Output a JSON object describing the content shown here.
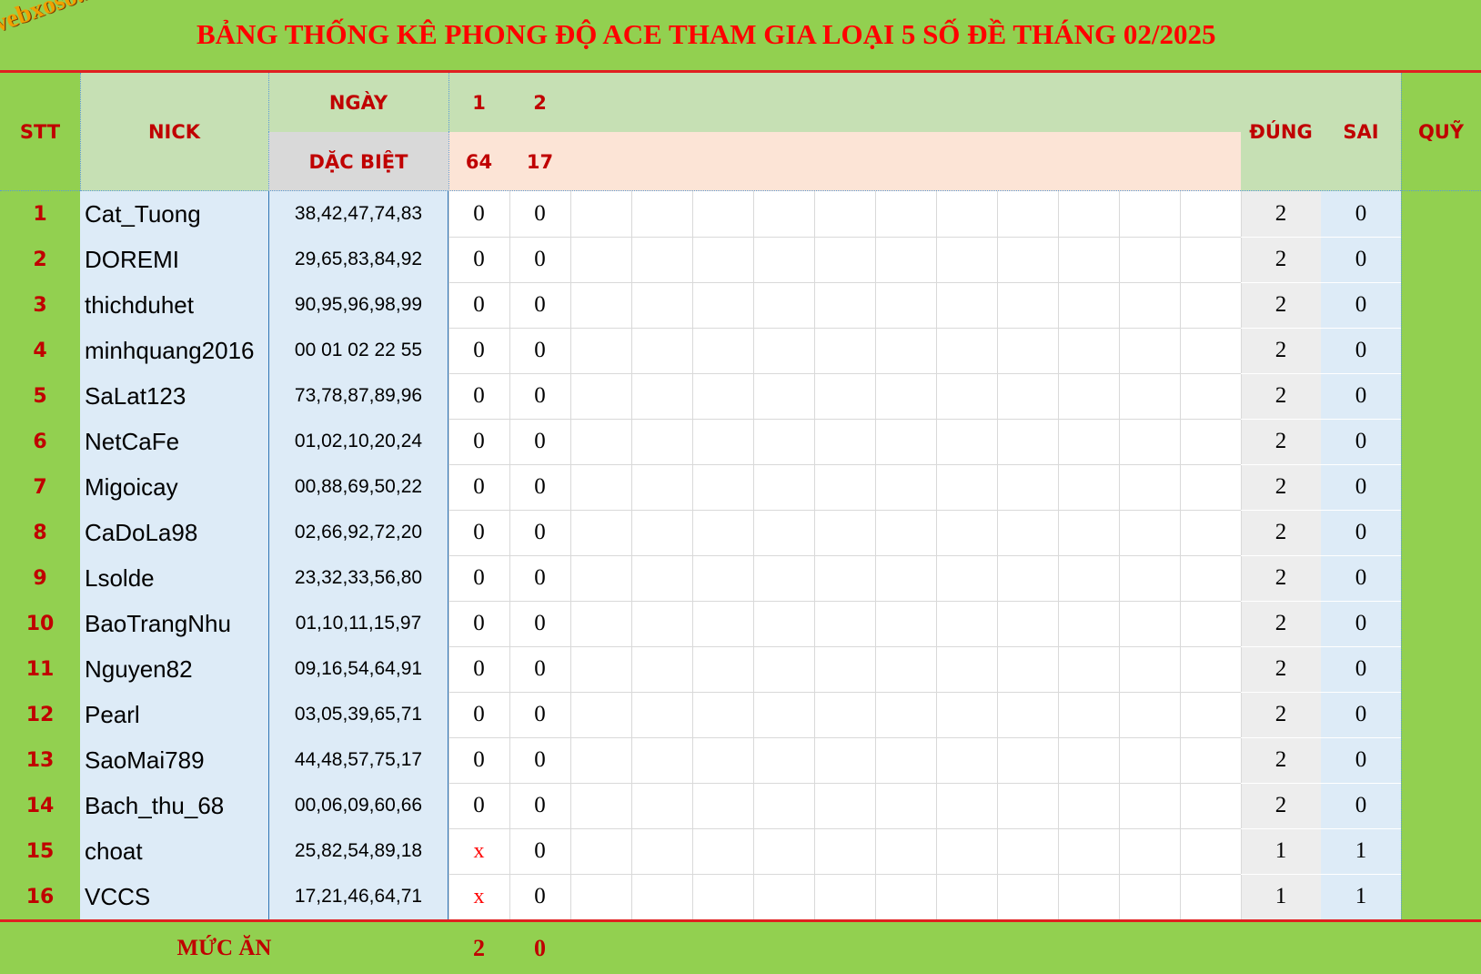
{
  "title": "BẢNG THỐNG KÊ PHONG ĐỘ ACE THAM GIA LOẠI 5 SỐ ĐỀ THÁNG 02/2025",
  "logo": "webxoso.net",
  "headers": {
    "stt": "STT",
    "nick": "NICK",
    "ngay": "NGÀY",
    "dac_biet": "DẶC BIỆT",
    "dung": "ĐÚNG",
    "sai": "SAI",
    "quy": "QUỸ"
  },
  "days": [
    "1",
    "2"
  ],
  "specials": [
    "64",
    "17"
  ],
  "rows": [
    {
      "stt": "1",
      "nick": "Cat_Tuong",
      "numbers": "38,42,47,74,83",
      "d1": "0",
      "d2": "0",
      "dung": "2",
      "sai": "0"
    },
    {
      "stt": "2",
      "nick": "DOREMI",
      "numbers": "29,65,83,84,92",
      "d1": "0",
      "d2": "0",
      "dung": "2",
      "sai": "0"
    },
    {
      "stt": "3",
      "nick": "thichduhet",
      "numbers": "90,95,96,98,99",
      "d1": "0",
      "d2": "0",
      "dung": "2",
      "sai": "0"
    },
    {
      "stt": "4",
      "nick": "minhquang2016",
      "numbers": "00 01 02 22 55",
      "d1": "0",
      "d2": "0",
      "dung": "2",
      "sai": "0"
    },
    {
      "stt": "5",
      "nick": "SaLat123",
      "numbers": "73,78,87,89,96",
      "d1": "0",
      "d2": "0",
      "dung": "2",
      "sai": "0"
    },
    {
      "stt": "6",
      "nick": "NetCaFe",
      "numbers": "01,02,10,20,24",
      "d1": "0",
      "d2": "0",
      "dung": "2",
      "sai": "0"
    },
    {
      "stt": "7",
      "nick": "Migoicay",
      "numbers": "00,88,69,50,22",
      "d1": "0",
      "d2": "0",
      "dung": "2",
      "sai": "0"
    },
    {
      "stt": "8",
      "nick": "CaDoLa98",
      "numbers": "02,66,92,72,20",
      "d1": "0",
      "d2": "0",
      "dung": "2",
      "sai": "0"
    },
    {
      "stt": "9",
      "nick": "Lsolde",
      "numbers": "23,32,33,56,80",
      "d1": "0",
      "d2": "0",
      "dung": "2",
      "sai": "0"
    },
    {
      "stt": "10",
      "nick": "BaoTrangNhu",
      "numbers": "01,10,11,15,97",
      "d1": "0",
      "d2": "0",
      "dung": "2",
      "sai": "0"
    },
    {
      "stt": "11",
      "nick": "Nguyen82",
      "numbers": "09,16,54,64,91",
      "d1": "0",
      "d2": "0",
      "dung": "2",
      "sai": "0"
    },
    {
      "stt": "12",
      "nick": "Pearl",
      "numbers": "03,05,39,65,71",
      "d1": "0",
      "d2": "0",
      "dung": "2",
      "sai": "0"
    },
    {
      "stt": "13",
      "nick": "SaoMai789",
      "numbers": "44,48,57,75,17",
      "d1": "0",
      "d2": "0",
      "dung": "2",
      "sai": "0"
    },
    {
      "stt": "14",
      "nick": "Bach_thu_68",
      "numbers": "00,06,09,60,66",
      "d1": "0",
      "d2": "0",
      "dung": "2",
      "sai": "0"
    },
    {
      "stt": "15",
      "nick": "choat",
      "numbers": "25,82,54,89,18",
      "d1": "x",
      "d2": "0",
      "dung": "1",
      "sai": "1"
    },
    {
      "stt": "16",
      "nick": "VCCS",
      "numbers": "17,21,46,64,71",
      "d1": "x",
      "d2": "0",
      "dung": "1",
      "sai": "1"
    }
  ],
  "footer": {
    "label": "MỨC ĂN",
    "d1": "2",
    "d2": "0"
  },
  "colors": {
    "green": "#92d050",
    "red": "#c00000",
    "light_blue": "#ddebf7",
    "light_green": "#c6e0b4",
    "peach": "#fce4d6",
    "gray": "#d9d9d9"
  }
}
